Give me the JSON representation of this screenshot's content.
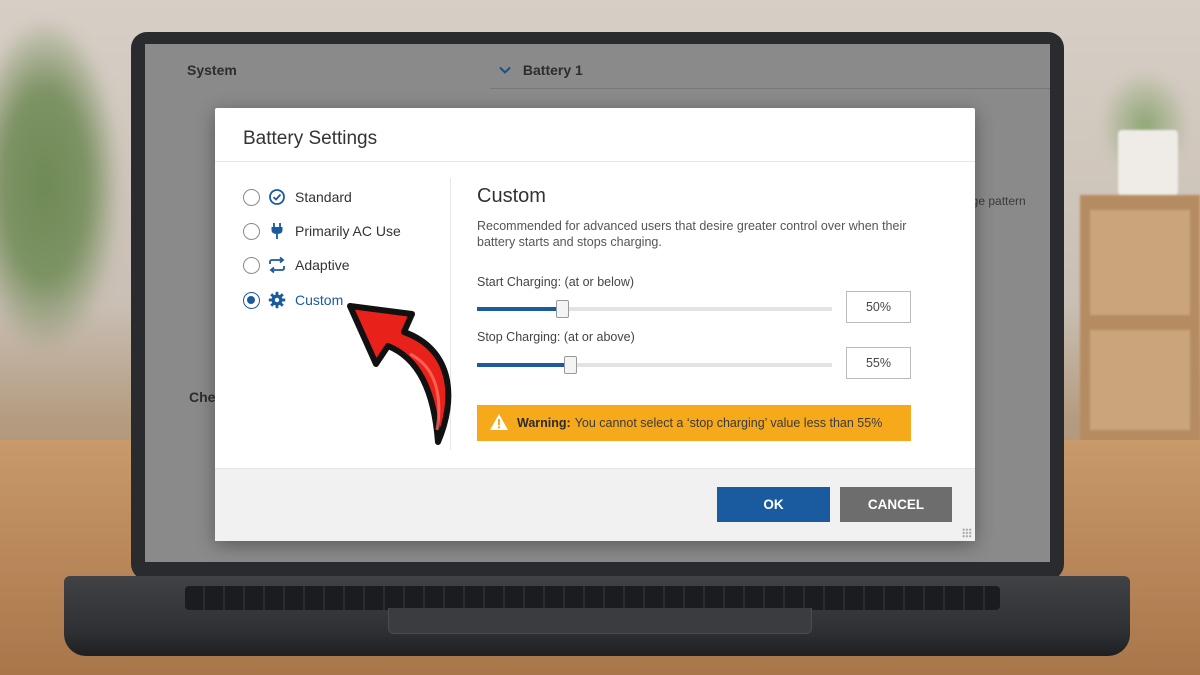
{
  "background_app": {
    "section_system": "System",
    "section_battery": "Battery 1",
    "usage_snippet": "age pattern",
    "cut_label": "Che"
  },
  "dialog": {
    "title": "Battery Settings",
    "options": [
      {
        "label": "Standard",
        "icon": "clock-check-icon",
        "selected": false
      },
      {
        "label": "Primarily AC Use",
        "icon": "plug-icon",
        "selected": false
      },
      {
        "label": "Adaptive",
        "icon": "repeat-icon",
        "selected": false
      },
      {
        "label": "Custom",
        "icon": "gear-icon",
        "selected": true
      }
    ],
    "panel": {
      "title": "Custom",
      "description": "Recommended for advanced users that desire greater control over when their battery starts and stops charging.",
      "start_label": "Start Charging: (at or below)",
      "start_value": "50%",
      "start_percent": 50,
      "stop_label": "Stop Charging: (at or above)",
      "stop_value": "55%",
      "stop_percent": 55,
      "warning_bold": "Warning:",
      "warning_text": "You cannot select a ‘stop charging’ value less than 55%"
    },
    "ok_label": "OK",
    "cancel_label": "CANCEL"
  },
  "colors": {
    "accent": "#1a5a9e",
    "warning": "#f5a91b",
    "cancel": "#6d6d6d",
    "annotation_arrow": "#e8221b"
  }
}
